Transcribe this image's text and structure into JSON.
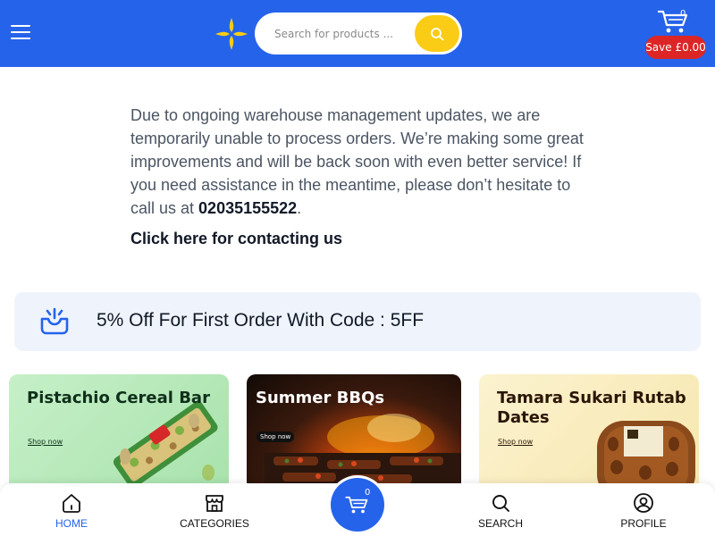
{
  "header": {
    "menu_icon": "hamburger-menu-icon",
    "logo_icon": "four-petal-star-logo",
    "search_placeholder": "Search for products ...",
    "search_icon": "search-icon",
    "cart_icon": "cart-icon",
    "cart_count": "0",
    "save_label": "Save £0.00",
    "colors": {
      "bar": "#2563eb",
      "search_button": "#facc15",
      "save_badge": "#dc2626",
      "logo": "#facc15"
    }
  },
  "notice": {
    "text": "Due to ongoing warehouse management updates, we are temporarily unable to process orders. We’re making some great improvements and will be back soon with even better service! If you need assistance in the meantime, please don’t hesitate to call us at ",
    "phone": "02035155522",
    "period": ".",
    "contact_link": "Click here for contacting us"
  },
  "promo": {
    "icon": "gift-box-icon",
    "text": "5% Off For First Order With Code : 5FF",
    "colors": {
      "background": "#eff4fc",
      "icon": "#2563eb"
    }
  },
  "banners": [
    {
      "title": "Pistachio Cereal Bar",
      "shop_label": "Shop now"
    },
    {
      "title": "Summer BBQs",
      "shop_label": "Shop now"
    },
    {
      "title": "Tamara Sukari Rutab Dates",
      "shop_label": "Shop now"
    }
  ],
  "bottom_nav": {
    "items": [
      {
        "label": "HOME",
        "icon": "home-icon",
        "active": true
      },
      {
        "label": "CATEGORIES",
        "icon": "store-icon"
      },
      {
        "label": "SEARCH",
        "icon": "search-icon"
      },
      {
        "label": "PROFILE",
        "icon": "user-circle-icon"
      }
    ],
    "center_cart": {
      "icon": "cart-icon",
      "count": "0"
    },
    "colors": {
      "active": "#2563eb",
      "inactive": "#111111"
    }
  }
}
